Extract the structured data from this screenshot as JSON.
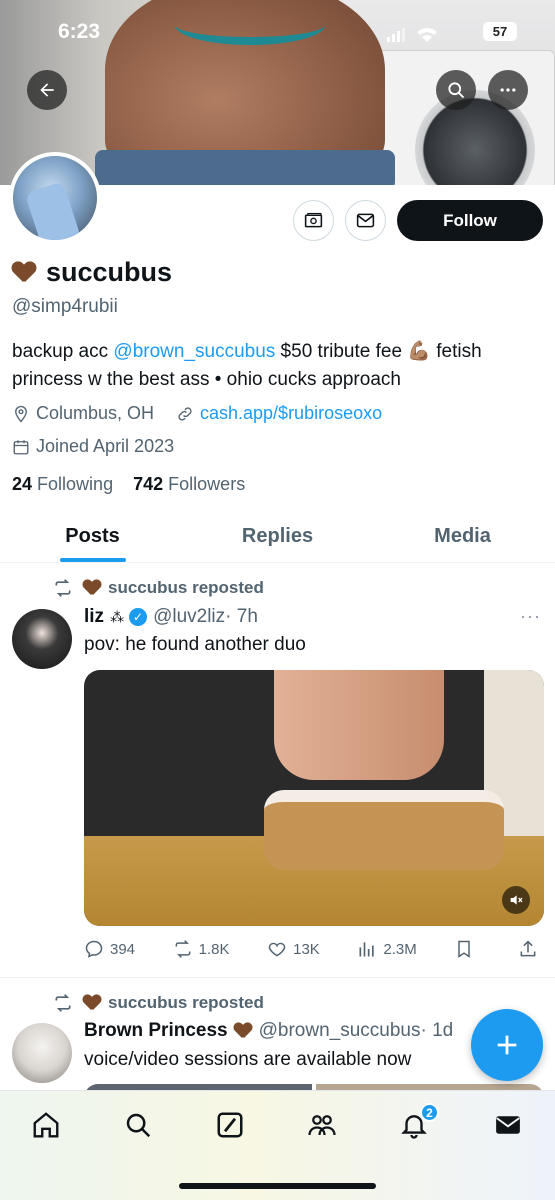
{
  "status_bar": {
    "time": "6:23",
    "battery": "57"
  },
  "header": {
    "back_icon": "arrow-left-icon",
    "search_icon": "search-icon",
    "more_icon": "more-horizontal-icon"
  },
  "profile": {
    "name": "succubus",
    "handle": "@simp4rubii",
    "bio_parts": {
      "before": "backup acc ",
      "mention": "@brown_succubus",
      "after": " $50 tribute fee 💪🏽 fetish princess w the best ass • ohio cucks approach"
    },
    "location": "Columbus, OH",
    "website": "cash.app/$rubiroseoxo",
    "joined": "Joined April 2023",
    "following_count": "24",
    "following_label": "Following",
    "followers_count": "742",
    "followers_label": "Followers",
    "follow_label": "Follow"
  },
  "tabs": [
    {
      "label": "Posts",
      "active": true
    },
    {
      "label": "Replies",
      "active": false
    },
    {
      "label": "Media",
      "active": false
    }
  ],
  "posts": [
    {
      "repost_label": "succubus reposted",
      "author_name": "liz",
      "author_suffix": "⁂",
      "author_handle": "@luv2liz",
      "time": "· 7h",
      "text": "pov: he found another duo",
      "replies": "394",
      "reposts": "1.8K",
      "likes": "13K",
      "views": "2.3M"
    },
    {
      "repost_label": "succubus reposted",
      "author_name": "Brown Princess",
      "author_handle": "@brown_succubus",
      "time": "· 1d",
      "text": "voice/video sessions are available now"
    }
  ],
  "nav": {
    "notifications_badge": "2"
  },
  "colors": {
    "accent": "#1d9bf0",
    "text": "#0f1419",
    "muted": "#536471"
  }
}
